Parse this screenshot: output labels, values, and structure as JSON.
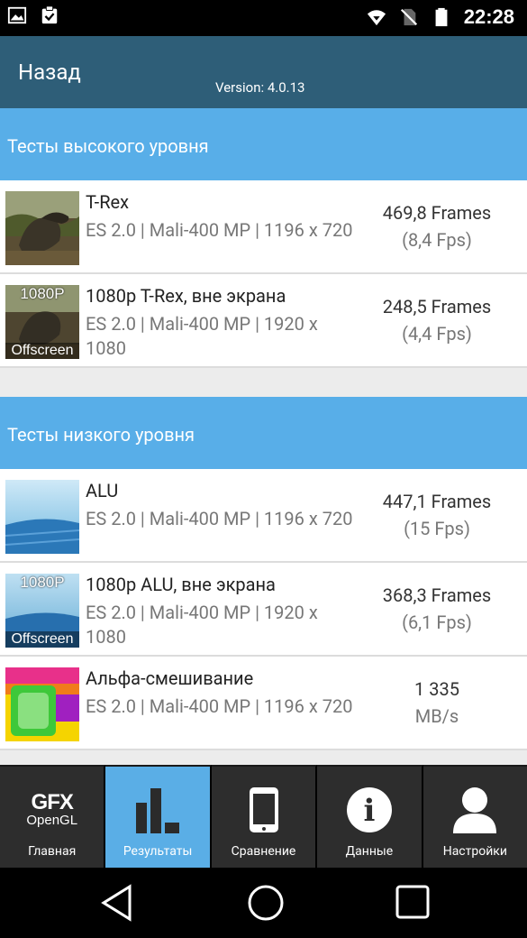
{
  "status_bar": {
    "time": "22:28"
  },
  "header": {
    "back_label": "Назад",
    "version": "Version: 4.0.13"
  },
  "sections": [
    {
      "title": "Тесты высокого уровня",
      "rows": [
        {
          "title": "T-Rex",
          "desc": "ES 2.0 | Mali-400 MP | 1196 x 720",
          "score": "469,8 Frames",
          "sub": "(8,4 Fps)",
          "tag_top": "",
          "tag_bottom": "",
          "thumb": "trex-thumbnail"
        },
        {
          "title": "1080p T-Rex, вне экрана",
          "desc": "ES 2.0 | Mali-400 MP | 1920 x 1080",
          "score": "248,5 Frames",
          "sub": "(4,4 Fps)",
          "tag_top": "1080P",
          "tag_bottom": "Offscreen",
          "thumb": "trex-offscreen-thumbnail"
        }
      ]
    },
    {
      "title": "Тесты низкого уровня",
      "rows": [
        {
          "title": "ALU",
          "desc": "ES 2.0 | Mali-400 MP | 1196 x 720",
          "score": "447,1 Frames",
          "sub": "(15 Fps)",
          "tag_top": "",
          "tag_bottom": "",
          "thumb": "alu-thumbnail"
        },
        {
          "title": "1080p ALU, вне экрана",
          "desc": "ES 2.0 | Mali-400 MP | 1920 x 1080",
          "score": "368,3 Frames",
          "sub": "(6,1 Fps)",
          "tag_top": "1080P",
          "tag_bottom": "Offscreen",
          "thumb": "alu-offscreen-thumbnail"
        },
        {
          "title": "Альфа-смешивание",
          "desc": "ES 2.0 | Mali-400 MP | 1196 x 720",
          "score": "1 335",
          "sub": "MB/s",
          "tag_top": "",
          "tag_bottom": "",
          "thumb": "alpha-blending-thumbnail"
        }
      ]
    }
  ],
  "tabs": [
    {
      "label": "Главная",
      "icon": "gfx-opengl-logo",
      "logo_line1": "GFX",
      "logo_line2": "OpenGL"
    },
    {
      "label": "Результаты",
      "icon": "bar-chart-icon",
      "active": true
    },
    {
      "label": "Сравнение",
      "icon": "phone-icon"
    },
    {
      "label": "Данные",
      "icon": "info-icon",
      "glyph": "i"
    },
    {
      "label": "Настройки",
      "icon": "person-icon"
    }
  ],
  "colors": {
    "header": "#2e5e78",
    "section": "#58aee8",
    "active_tab": "#5aaee6"
  }
}
